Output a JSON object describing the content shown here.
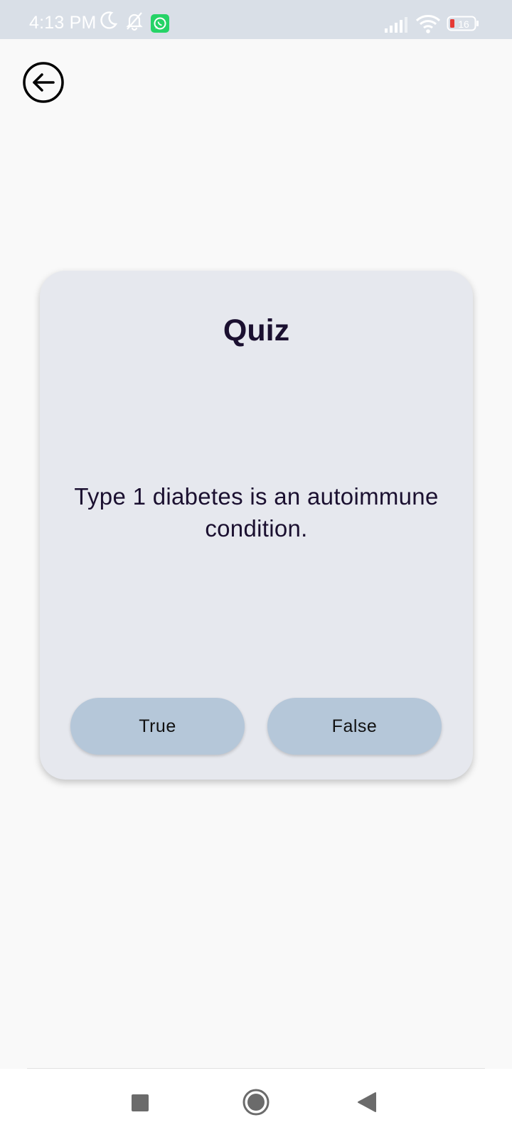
{
  "status_bar": {
    "time": "4:13 PM",
    "battery_level": "16",
    "icons": [
      "moon-icon",
      "bell-off-icon",
      "whatsapp-icon",
      "signal-icon",
      "wifi-icon",
      "battery-icon"
    ],
    "colors": {
      "background": "#d9dfe7",
      "whatsapp": "#25d366",
      "battery_low": "#e53935"
    }
  },
  "header": {
    "back_icon": "arrow-left-circle-icon"
  },
  "quiz": {
    "title": "Quiz",
    "question": "Type 1 diabetes is an autoimmune condition.",
    "true_label": "True",
    "false_label": "False",
    "colors": {
      "card": "#e6e8ee",
      "button": "#b5c7d9",
      "text": "#1b1030"
    }
  },
  "nav_bar": {
    "icons": [
      "recents-square-icon",
      "home-circle-icon",
      "back-triangle-icon"
    ]
  }
}
